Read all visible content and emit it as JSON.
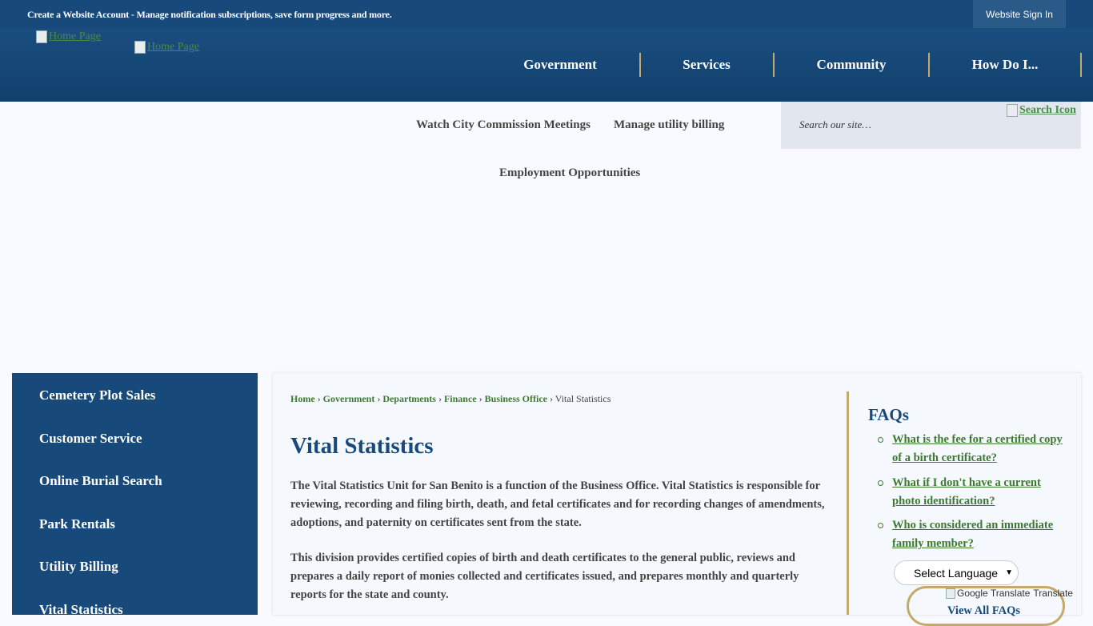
{
  "topbar": {
    "message": "Create a Website Account - Manage notification subscriptions, save form progress and more.",
    "signin_label": "Website Sign In"
  },
  "header": {
    "logo1_alt": "Home Page",
    "logo2_alt": "Home Page",
    "nav": [
      "Government",
      "Services",
      "Community",
      "How Do I..."
    ]
  },
  "quicklinks": [
    "Watch City Commission Meetings",
    "Manage utility billing",
    "Employment Opportunities"
  ],
  "search": {
    "placeholder": "Search our site…",
    "icon_alt": "Search Icon"
  },
  "sidebar": {
    "items": [
      "Cemetery Plot Sales",
      "Customer Service",
      "Online Burial Search",
      "Park Rentals",
      "Utility Billing",
      "Vital Statistics"
    ]
  },
  "breadcrumb": {
    "links": [
      "Home",
      "Government",
      "Departments",
      "Finance",
      "Business Office"
    ],
    "current": "Vital Statistics",
    "separator": "›"
  },
  "main": {
    "title": "Vital Statistics",
    "paragraphs": [
      "The Vital Statistics Unit for San Benito is a function of the Business Office. Vital Statistics is responsible for reviewing, recording and filing birth, death, and fetal certificates and for recording changes of amendments, adoptions, and paternity on certificates sent from the state.",
      "This division provides certified copies of birth and death certificates to the general public, reviews and prepares a daily report of monies collected and certificates issued, and prepares monthly and quarterly reports for the state and county."
    ]
  },
  "faqs": {
    "title": "FAQs",
    "items": [
      "What is the fee for a certified copy of a birth certificate?",
      "What if I don't have a current photo identification?",
      "Who is considered an immediate family member?"
    ],
    "view_all": "View All FAQs"
  },
  "translate": {
    "select_label": "Select Language",
    "google_alt": "Google Translate",
    "translate_label": "Translate"
  },
  "colors": {
    "navy": "#17497a",
    "gold": "#c5a96b",
    "link_green": "#3d7a2f"
  }
}
